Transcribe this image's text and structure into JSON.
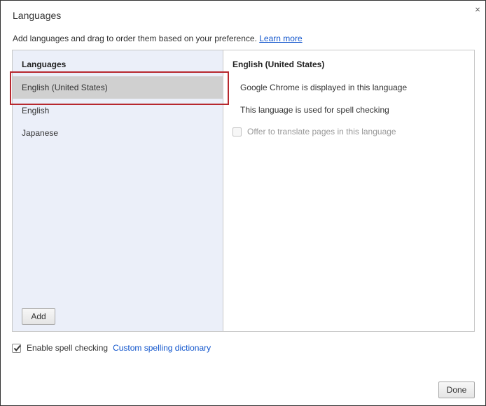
{
  "dialog": {
    "title": "Languages",
    "close_glyph": "×"
  },
  "description": {
    "text": "Add languages and drag to order them based on your preference. ",
    "link": "Learn more"
  },
  "languages_list": {
    "header": "Languages",
    "items": [
      {
        "label": "English (United States)",
        "selected": true
      },
      {
        "label": "English",
        "selected": false
      },
      {
        "label": "Japanese",
        "selected": false
      }
    ],
    "add_label": "Add"
  },
  "details": {
    "header": "English (United States)",
    "display_text": "Google Chrome is displayed in this language",
    "spell_text": "This language is used for spell checking",
    "translate_label": "Offer to translate pages in this language",
    "translate_checked": false
  },
  "spellcheck": {
    "label": "Enable spell checking",
    "checked": true,
    "dictionary_link": "Custom spelling dictionary"
  },
  "footer": {
    "done_label": "Done"
  },
  "colors": {
    "link": "#1155cc",
    "list_background": "#ebeff9",
    "selected_row": "#d0d0d0",
    "highlight_border": "#b7282e"
  }
}
